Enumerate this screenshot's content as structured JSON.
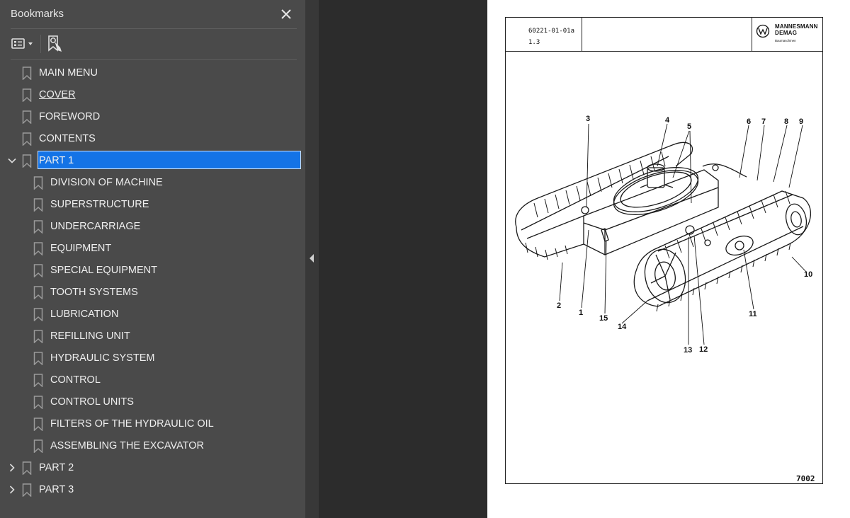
{
  "panel": {
    "title": "Bookmarks",
    "close_icon": "close-icon",
    "toolbar": {
      "options_icon": "list-options-icon",
      "find_icon": "find-bookmark-icon"
    }
  },
  "bookmarks": [
    {
      "label": "MAIN MENU",
      "level": 0,
      "expander": "none"
    },
    {
      "label": "COVER",
      "level": 0,
      "expander": "none",
      "underline": true
    },
    {
      "label": "FOREWORD",
      "level": 0,
      "expander": "none"
    },
    {
      "label": "CONTENTS",
      "level": 0,
      "expander": "none"
    },
    {
      "label": "PART 1",
      "level": 0,
      "expander": "expanded",
      "selected": true
    },
    {
      "label": "DIVISION OF MACHINE",
      "level": 1,
      "expander": "none"
    },
    {
      "label": "SUPERSTRUCTURE",
      "level": 1,
      "expander": "none"
    },
    {
      "label": "UNDERCARRIAGE",
      "level": 1,
      "expander": "none"
    },
    {
      "label": "EQUIPMENT",
      "level": 1,
      "expander": "none"
    },
    {
      "label": "SPECIAL EQUIPMENT",
      "level": 1,
      "expander": "none"
    },
    {
      "label": "TOOTH SYSTEMS",
      "level": 1,
      "expander": "none"
    },
    {
      "label": "LUBRICATION",
      "level": 1,
      "expander": "none"
    },
    {
      "label": "REFILLING UNIT",
      "level": 1,
      "expander": "none"
    },
    {
      "label": "HYDRAULIC SYSTEM",
      "level": 1,
      "expander": "none"
    },
    {
      "label": "CONTROL",
      "level": 1,
      "expander": "none"
    },
    {
      "label": "CONTROL UNITS",
      "level": 1,
      "expander": "none"
    },
    {
      "label": "FILTERS OF THE HYDRAULIC OIL",
      "level": 1,
      "expander": "none"
    },
    {
      "label": "ASSEMBLING THE EXCAVATOR",
      "level": 1,
      "expander": "none"
    },
    {
      "label": "PART 2",
      "level": 0,
      "expander": "collapsed"
    },
    {
      "label": "PART 3",
      "level": 0,
      "expander": "collapsed"
    }
  ],
  "document": {
    "code": "60221-01-01a",
    "section": "1.3",
    "brand_line1": "MANNESMANN",
    "brand_line2": "DEMAG",
    "brand_line3": "Baumaschinen",
    "page_number": "7002",
    "callouts": [
      "1",
      "2",
      "3",
      "4",
      "5",
      "6",
      "7",
      "8",
      "9",
      "10",
      "11",
      "12",
      "13",
      "14",
      "15"
    ]
  },
  "colors": {
    "panel_bg": "#4a4a4a",
    "selection": "#1473e6",
    "viewer_bg": "#2c2c2c",
    "page": "#ffffff"
  }
}
